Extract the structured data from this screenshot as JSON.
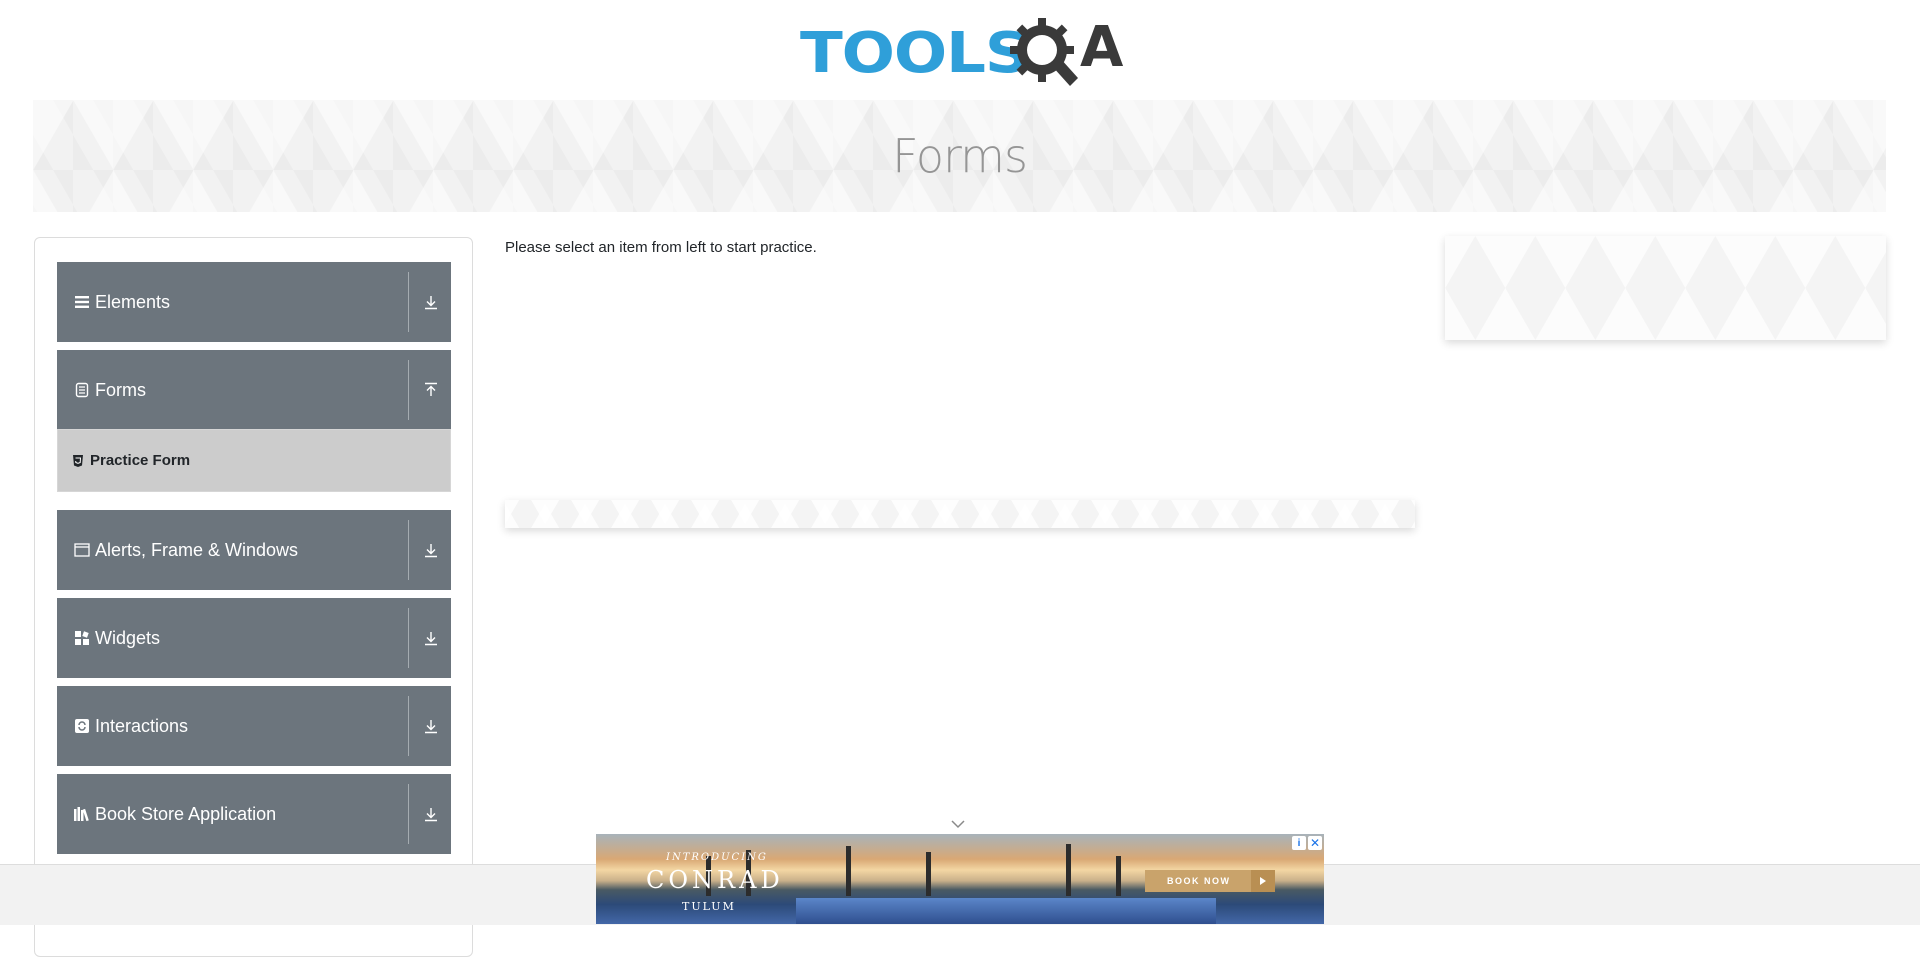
{
  "header": {
    "logo_text_left": "TOOLS",
    "logo_text_right": "A",
    "logo_alt": "ToolsQA"
  },
  "banner": {
    "title": "Forms"
  },
  "sidebar": {
    "groups": [
      {
        "label": "Elements",
        "icon": "list-icon",
        "state": "collapsed"
      },
      {
        "label": "Forms",
        "icon": "form-icon",
        "state": "expanded"
      },
      {
        "label": "Alerts, Frame & Windows",
        "icon": "window-icon",
        "state": "collapsed"
      },
      {
        "label": "Widgets",
        "icon": "widgets-icon",
        "state": "collapsed"
      },
      {
        "label": "Interactions",
        "icon": "interactions-icon",
        "state": "collapsed"
      },
      {
        "label": "Book Store Application",
        "icon": "book-icon",
        "state": "collapsed"
      }
    ],
    "forms_items": [
      {
        "label": "Practice Form",
        "icon": "html5-icon"
      }
    ]
  },
  "main": {
    "instruction": "Please select an item from left to start practice."
  },
  "bottom_ad": {
    "intro": "INTRODUCING",
    "brand": "CONRAD",
    "location": "TULUM",
    "cta": "BOOK NOW",
    "info_label": "i",
    "close_label": "✕"
  },
  "colors": {
    "sidebar_group_bg": "#6c757d",
    "sub_item_bg": "#cccccc",
    "logo_blue": "#2f9fd9",
    "logo_dark": "#3a3a3a",
    "banner_title": "#959595"
  }
}
